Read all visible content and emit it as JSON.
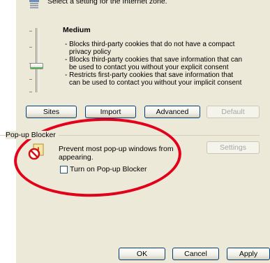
{
  "zone_instruction": "Select a setting for the Internet zone.",
  "level_title": "Medium",
  "level_bullets": [
    "- Blocks third-party cookies that do not have a compact",
    "privacy policy",
    "- Blocks third-party cookies that save information that can",
    "be used to contact you without your explicit consent",
    "- Restricts first-party cookies that save information that",
    "can be used to contact you without your implicit consent"
  ],
  "privacy_buttons": {
    "sites": "Sites",
    "import": "Import",
    "advanced": "Advanced",
    "default": "Default"
  },
  "popup_blocker": {
    "group_label": "Pop-up Blocker",
    "description_line1": "Prevent most pop-up windows from",
    "description_line2": "appearing.",
    "checkbox_label": "Turn on Pop-up Blocker",
    "checkbox_checked": false,
    "settings_button": "Settings"
  },
  "dialog_buttons": {
    "ok": "OK",
    "cancel": "Cancel",
    "apply": "Apply"
  },
  "slider_level": "Medium",
  "annotation_color": "#e2001a"
}
